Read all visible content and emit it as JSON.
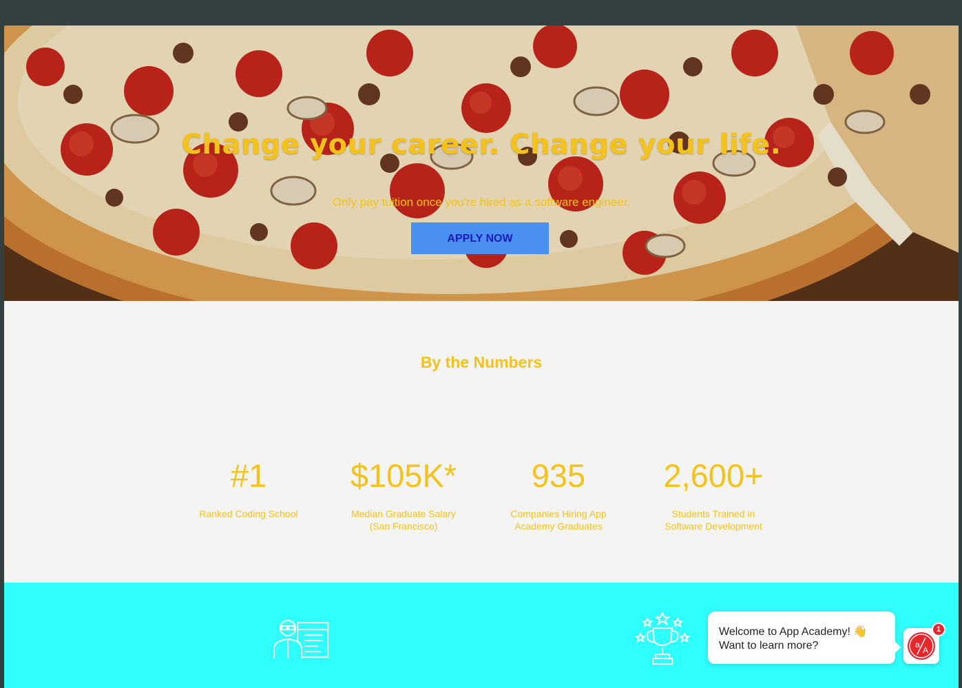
{
  "hero": {
    "title": "Change your career. Change your life.",
    "subtitle": "Only pay tuition once you're hired as a software engineer.",
    "apply_label": "APPLY NOW"
  },
  "numbers": {
    "title": "By the Numbers",
    "stats": [
      {
        "value": "#1",
        "label": "Ranked Coding School"
      },
      {
        "value": "$105K*",
        "label": "Median Graduate Salary (San Francisco)"
      },
      {
        "value": "935",
        "label": "Companies Hiring App Academy Graduates"
      },
      {
        "value": "2,600+",
        "label": "Students Trained in Software Development"
      }
    ]
  },
  "features": {
    "icons": [
      "instructor-icon",
      "trophy-icon"
    ]
  },
  "chat": {
    "line1": "Welcome to App Academy! 👋",
    "line2": "Want to learn more?",
    "badge_count": "1",
    "launcher_icon": "app-academy-logo-icon"
  },
  "colors": {
    "accent_yellow": "#f5c21a",
    "button_blue": "#4a90f0",
    "button_text": "#1a1ab8",
    "section_cyan": "#30ffff",
    "section_gray": "#f4f4f4",
    "frame_dark": "#343f3f",
    "badge_red": "#e8262b"
  }
}
